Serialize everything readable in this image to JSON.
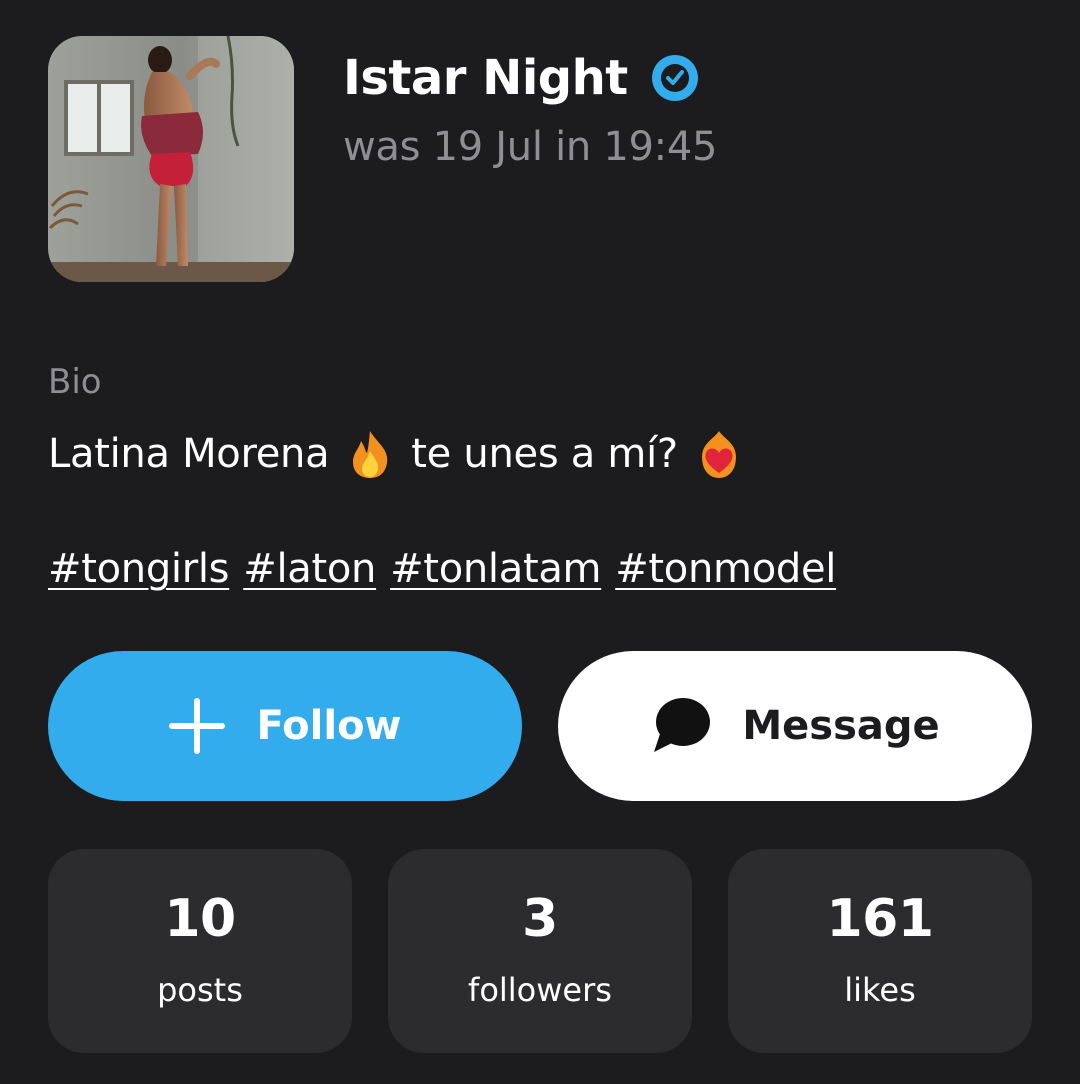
{
  "profile": {
    "name": "Istar Night",
    "last_seen": "was 19 Jul in 19:45",
    "verified": true,
    "avatar_alt": "profile photo"
  },
  "bio": {
    "label": "Bio",
    "text_part1": "Latina Morena",
    "emoji1": "fire-emoji",
    "text_part2": "te unes a mí?",
    "emoji2": "heart-on-fire-emoji"
  },
  "hashtags": [
    "#tongirls",
    "#laton",
    "#tonlatam",
    "#tonmodel"
  ],
  "actions": {
    "follow_label": "Follow",
    "message_label": "Message"
  },
  "stats": [
    {
      "value": "10",
      "label": "posts"
    },
    {
      "value": "3",
      "label": "followers"
    },
    {
      "value": "161",
      "label": "likes"
    }
  ],
  "colors": {
    "background": "#1c1c1e",
    "card": "#2c2c2e",
    "accent": "#32aced",
    "muted_text": "#8e8e93"
  }
}
